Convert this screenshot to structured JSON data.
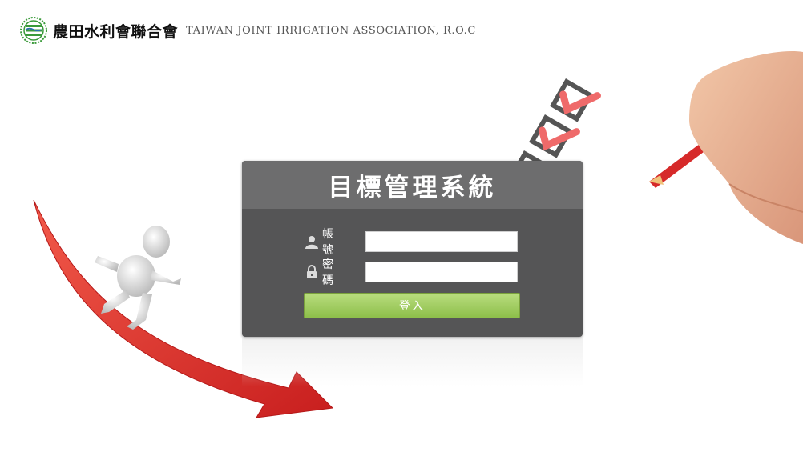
{
  "header": {
    "org_name_cn": "農田水利會聯合會",
    "org_name_en": "TAIWAN JOINT IRRIGATION ASSOCIATION, R.O.C"
  },
  "login": {
    "title": "目標管理系統",
    "account_label": "帳號",
    "password_label": "密碼",
    "account_value": "",
    "password_value": "",
    "submit_label": "登入"
  },
  "colors": {
    "panel": "#555556",
    "title_bar": "#6d6d6e",
    "button_top": "#b9dd7e",
    "button_bottom": "#8dbf4a",
    "arrow_red": "#e02b2b",
    "logo_green": "#3a9a3a"
  },
  "icons": {
    "account": "user-icon",
    "password": "lock-icon"
  }
}
